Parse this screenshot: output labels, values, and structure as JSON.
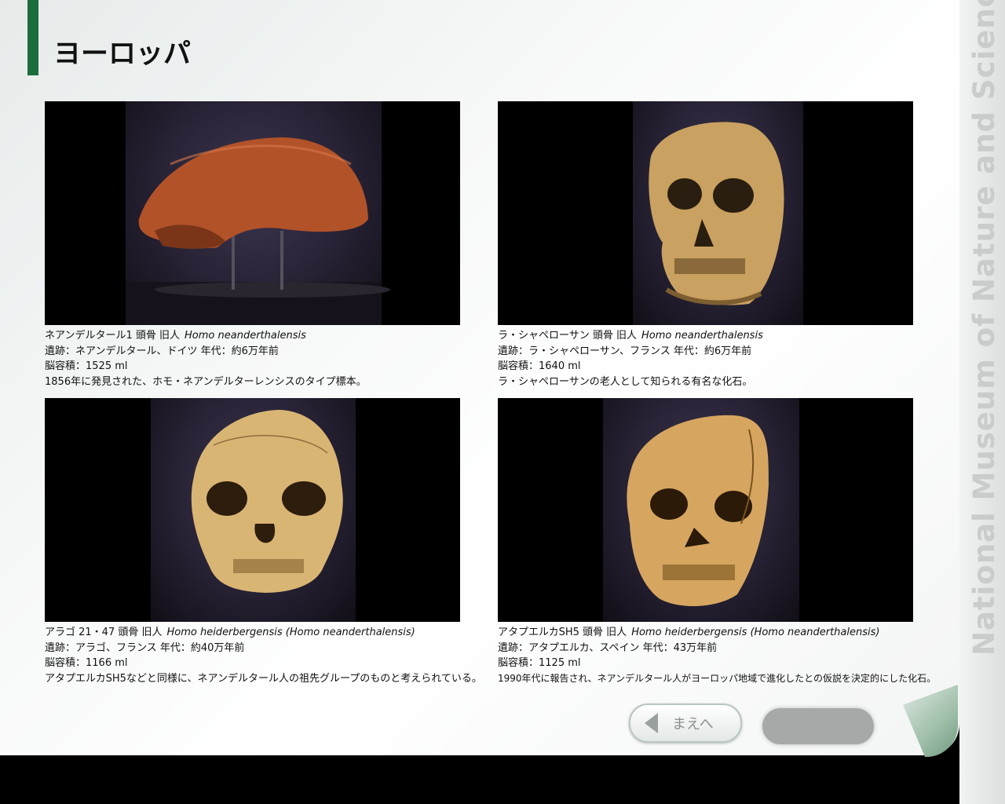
{
  "page": {
    "title": "ヨーロッパ",
    "side_label": "National Museum of Nature and Science"
  },
  "specimens": [
    {
      "name": "ネアンデルタール1 頭骨 旧人",
      "scientific": "Homo neanderthalensis",
      "site": "遺跡：ネアンデルタール、ドイツ 年代：約6万年前",
      "brain": "脳容積：1525 ml",
      "note": "1856年に発見された、ホモ・ネアンデルターレンシスのタイプ標本。"
    },
    {
      "name": "ラ・シャペローサン 頭骨 旧人",
      "scientific": "Homo neanderthalensis",
      "site": "遺跡：ラ・シャペローサン、フランス 年代：約6万年前",
      "brain": "脳容積：1640 ml",
      "note": "ラ・シャペローサンの老人として知られる有名な化石。"
    },
    {
      "name": "アラゴ 21・47 頭骨 旧人",
      "scientific": "Homo heiderbergensis (Homo neanderthalensis)",
      "site": "遺跡：アラゴ、フランス 年代：約40万年前",
      "brain": "脳容積：1166 ml",
      "note": "アタプエルカSH5などと同様に、ネアンデルタール人の祖先グループのものと考えられている。"
    },
    {
      "name": "アタプエルカSH5 頭骨 旧人",
      "scientific": "Homo heiderbergensis (Homo neanderthalensis)",
      "site": "遺跡：アタプエルカ、スペイン 年代：43万年前",
      "brain": "脳容積：1125 ml",
      "note": "1990年代に報告され、ネアンデルタール人がヨーロッパ地域で進化したとの仮説を決定的にした化石。"
    }
  ],
  "nav": {
    "prev_label": "まえへ"
  },
  "colors": {
    "accent": "#1b6d3d",
    "skull_orange": "#b5562a",
    "skull_bone": "#c9a160"
  }
}
